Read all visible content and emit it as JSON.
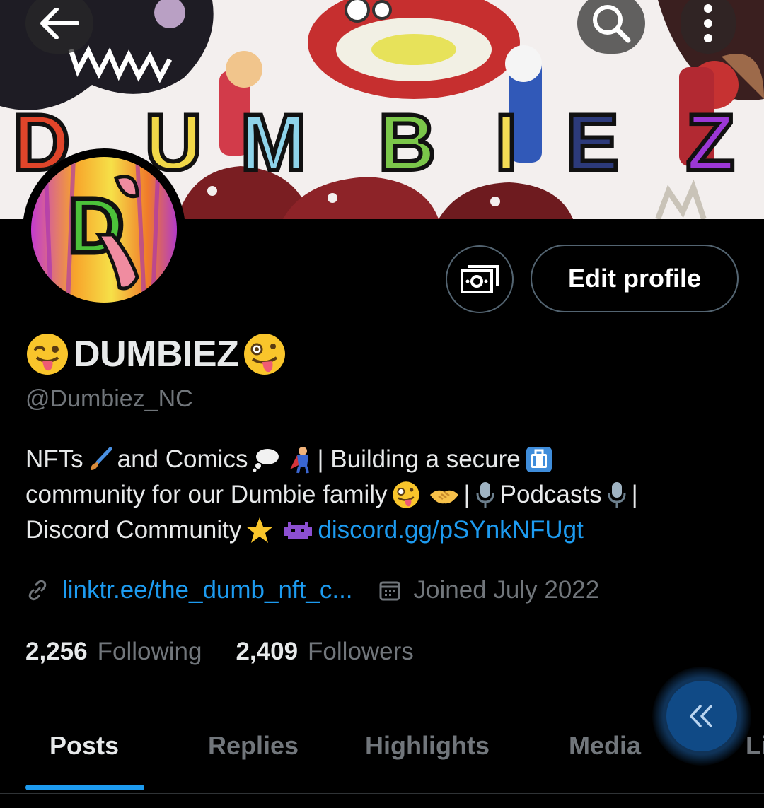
{
  "banner": {
    "letters": [
      "D",
      "U",
      "M",
      "B",
      "I",
      "E",
      "Z"
    ]
  },
  "top_bar": {
    "back_icon": "arrow-left-icon",
    "search_icon": "search-icon",
    "more_icon": "more-vertical-icon"
  },
  "actions": {
    "icon_button_icon": "money-icon",
    "edit_label": "Edit profile"
  },
  "profile": {
    "name": "DUMBIEZ",
    "handle": "@Dumbiez_NC",
    "bio_line1_a": "NFTs",
    "bio_line1_b": "and Comics",
    "bio_line1_c": "| Building a secure",
    "bio_line2_a": "community for our Dumbie family",
    "bio_line2_b": "|",
    "bio_line2_c": "Podcasts",
    "bio_line2_d": "|",
    "bio_line3_a": "Discord Community",
    "bio_link": "discord.gg/pSYnkNFUgt",
    "website": "linktr.ee/the_dumb_nft_c...",
    "joined": "Joined July 2022",
    "following_count": "2,256",
    "following_label": "Following",
    "followers_count": "2,409",
    "followers_label": "Followers"
  },
  "tabs": [
    {
      "label": "Posts",
      "active": true
    },
    {
      "label": "Replies",
      "active": false
    },
    {
      "label": "Highlights",
      "active": false
    },
    {
      "label": "Media",
      "active": false
    },
    {
      "label": "Li",
      "active": false
    }
  ],
  "colors": {
    "accent": "#1d9bf0",
    "background": "#000000",
    "muted": "#71767b",
    "fab": "#104a86"
  }
}
